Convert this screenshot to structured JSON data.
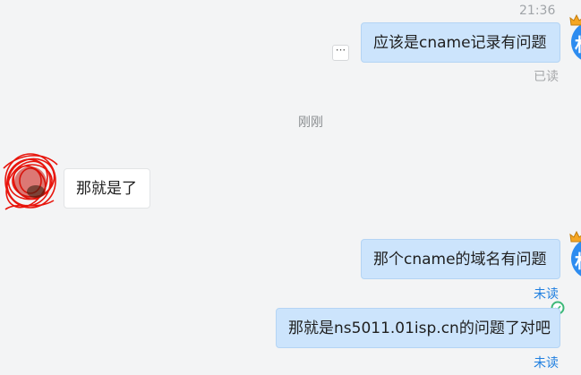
{
  "conversation": {
    "messages": [
      {
        "id": "m1",
        "direction": "out",
        "text": "应该是cname记录有问题",
        "status": "已读",
        "time": "21:36"
      },
      {
        "id": "m2",
        "direction": "in",
        "text": "那就是了"
      },
      {
        "id": "m3",
        "direction": "out",
        "text": "那个cname的域名有问题",
        "status": "未读"
      },
      {
        "id": "m4",
        "direction": "out",
        "text": "那就是ns5011.01isp.cn的问题了对吧",
        "status": "未读"
      }
    ],
    "divider_time": "刚刚",
    "more_label": "···",
    "avatar_letter": "林"
  },
  "colors": {
    "background": "#f3f4f5",
    "outgoing_bubble": "#cce4fc",
    "incoming_bubble": "#ffffff",
    "unread_status": "#1f7fe0",
    "read_status": "#a6a8aa",
    "avatar_blue": "#2d8cf0",
    "sent_check": "#3cb878",
    "redaction_scribble": "#e8150c"
  },
  "icons": {
    "more": "ellipsis-icon",
    "sent": "check-circle-icon",
    "avatar_badge": "crown-icon"
  }
}
